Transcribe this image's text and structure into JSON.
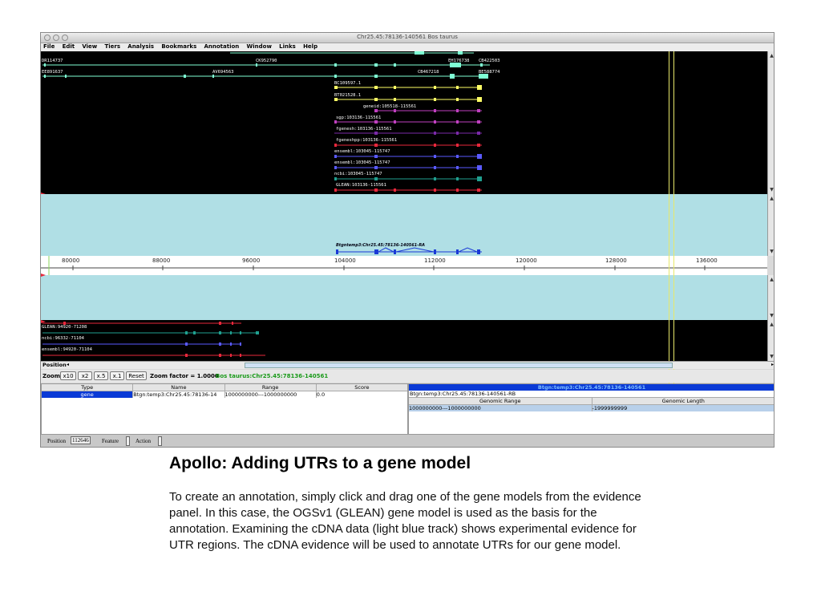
{
  "window": {
    "title": "Chr25.45:78136-140561 Bos taurus"
  },
  "menu": [
    "File",
    "Edit",
    "View",
    "Tiers",
    "Analysis",
    "Bookmarks",
    "Annotation",
    "Window",
    "Links",
    "Help"
  ],
  "top_labels": [
    "DR114737",
    "EE891637",
    "CK952790",
    "AV694563",
    "EH176738",
    "CB422503",
    "CB467218",
    "BE588774",
    "BC109597.1",
    "BT021528.1",
    "geneid:105518-115561",
    "sgp:103136-115561",
    "fgenesh:103136-115561",
    "fgeneshpp:103136-115561",
    "ensembl:103045-115747",
    "ensembl:103045-115747",
    "ncbi:103045-115747",
    "GLEAN:103136-115561"
  ],
  "gene_model_label": "Btgntemp3:Chr25.45:78136-140561-RA",
  "ruler_ticks": [
    "80000",
    "88000",
    "96000",
    "104000",
    "112000",
    "120000",
    "128000",
    "136000"
  ],
  "bottom_labels": [
    "GLEAN:94920-71208",
    "ncbi:96332-71104",
    "ensembl:94920-71104"
  ],
  "position_label": "Position",
  "zoom": {
    "label": "Zoom",
    "buttons": [
      "x10",
      "x2",
      "x.5",
      "x.1",
      "Reset"
    ],
    "factor": "Zoom factor = 1.0000",
    "location": "Bos taurus:Chr25.45:78136-140561"
  },
  "feature_table": {
    "headers": [
      "Type",
      "Name",
      "Range",
      "Score"
    ],
    "row": [
      "gene",
      "Btgn:temp3:Chr25.45:78136-14",
      "1000000000---1000000000",
      "0.0"
    ]
  },
  "detail": {
    "header": "Btgn:temp3:Chr25.45:78136-140561",
    "name": "Btgn:temp3:Chr25.45:78136-140561-RB",
    "headers": [
      "Genomic Range",
      "Genomic Length"
    ],
    "row": [
      "1000000000---1000000000",
      "-1999999999"
    ]
  },
  "status": {
    "position_label": "Position",
    "position_value": "112646",
    "feature_label": "Feature",
    "action_label": "Action"
  },
  "slide": {
    "heading": "Apollo: Adding UTRs to a gene model",
    "paragraph": "To create an annotation, simply click and drag one of the gene models from the evidence panel.  In this case, the OGSv1 (GLEAN) gene model is used as the basis for the annotation.  Examining the cDNA data (light blue track) shows experimental evidence for UTR regions.  The cDNA evidence will be used to annotate UTRs for our gene model."
  },
  "colors": {
    "evidence_black": "#000000",
    "cdna_cyan": "#b0dfe5",
    "selection": "#e8e86a",
    "selected_row": "#0a3ad6"
  }
}
